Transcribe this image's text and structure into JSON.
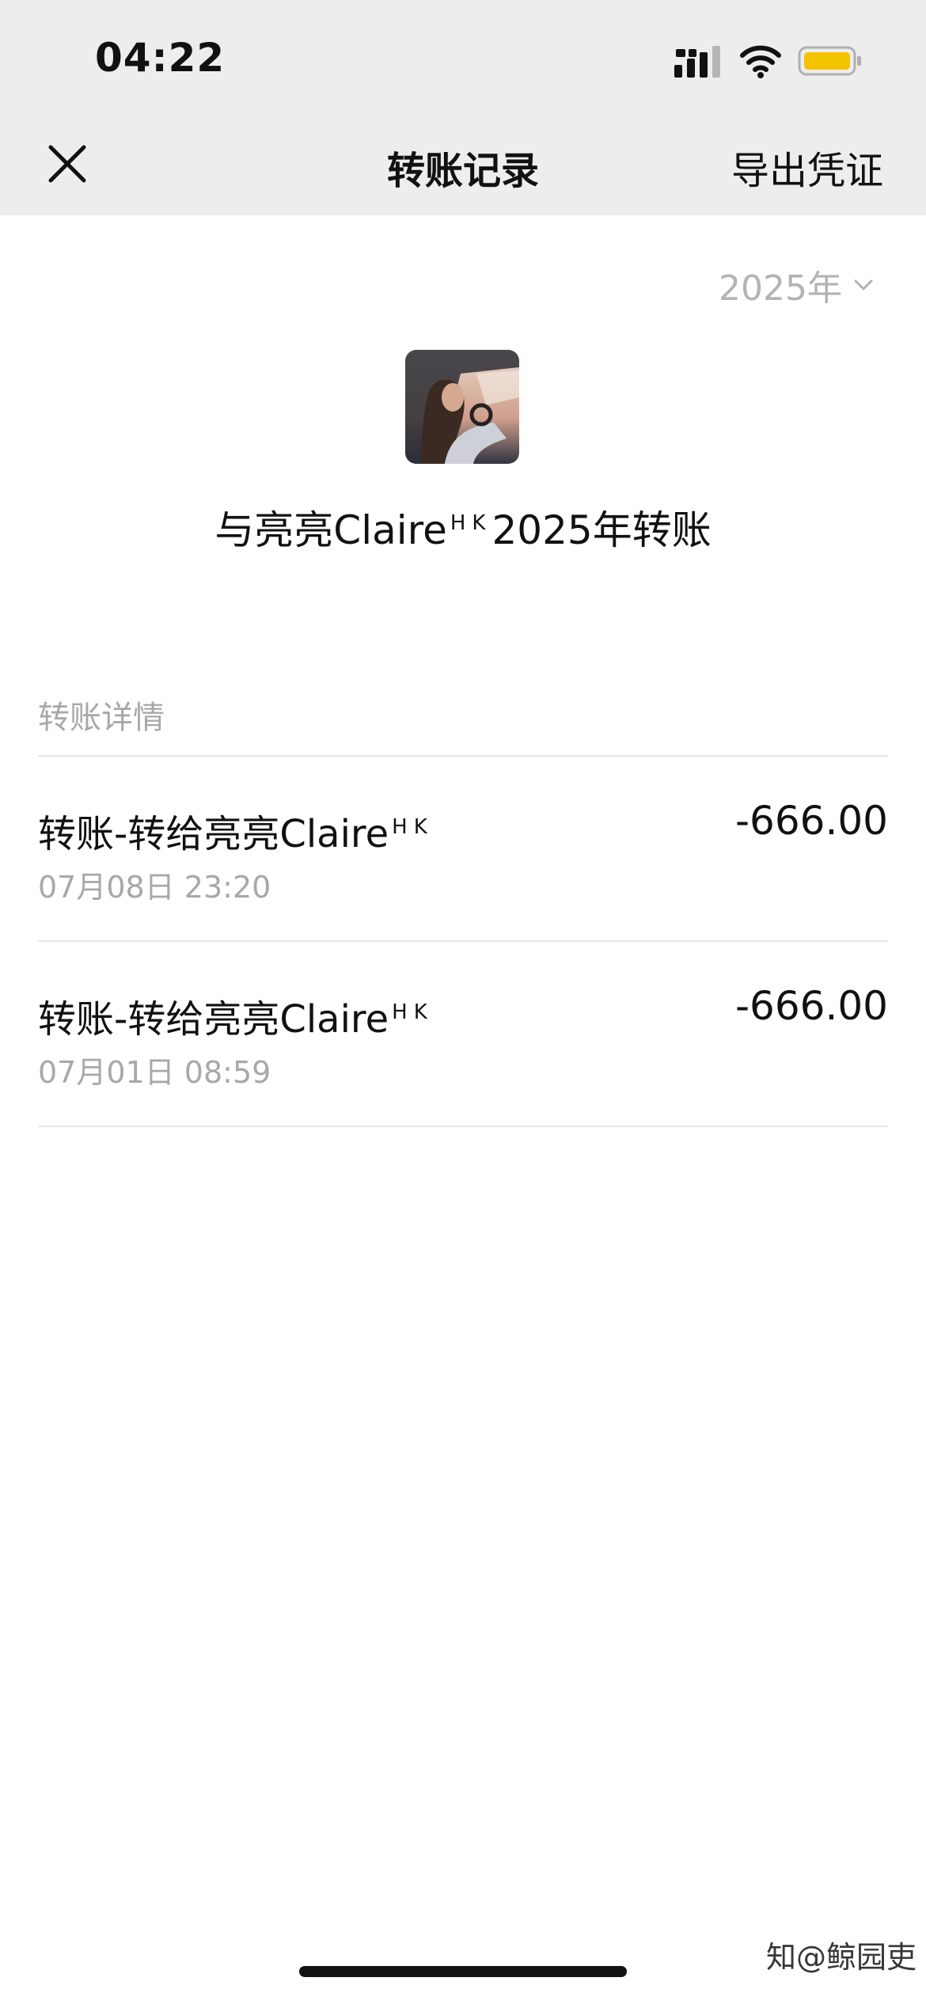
{
  "status_bar": {
    "time": "04:22",
    "battery_color": "#f5c400",
    "icons": [
      "cellular-signal-icon",
      "wifi-icon",
      "battery-icon"
    ]
  },
  "nav": {
    "close_icon": "close-icon",
    "title": "转账记录",
    "export_label": "导出凭证"
  },
  "filter": {
    "year_label": "2025年",
    "dropdown_icon": "chevron-down-icon"
  },
  "summary": {
    "title_prefix": "与亮亮Claire",
    "title_sup": "HK",
    "title_suffix": "2025年转账"
  },
  "section": {
    "label": "转账详情"
  },
  "transactions": [
    {
      "title": "转账-转给亮亮Claire",
      "title_sup": "HK",
      "time": "07月08日 23:20",
      "amount": "-666.00"
    },
    {
      "title": "转账-转给亮亮Claire",
      "title_sup": "HK",
      "time": "07月01日 08:59",
      "amount": "-666.00"
    }
  ],
  "watermark": "知@鲸园吏"
}
